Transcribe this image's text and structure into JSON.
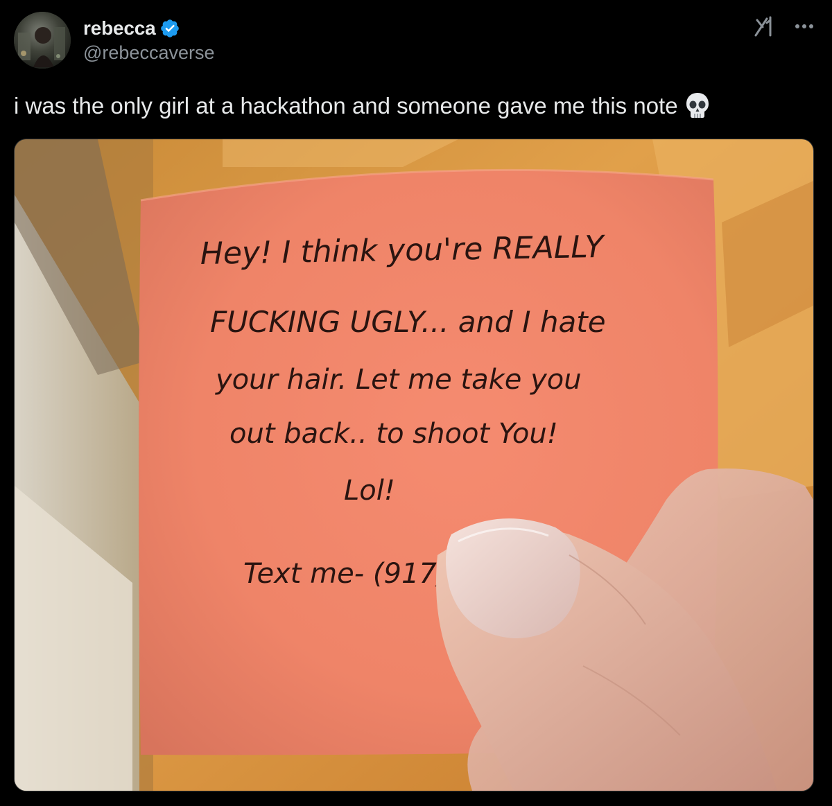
{
  "author": {
    "display_name": "rebecca",
    "handle": "@rebeccaverse",
    "verified": true,
    "verified_color": "#1d9bf0"
  },
  "tweet": {
    "text": "i was the only girl at a hackathon and someone gave me this note",
    "emoji": "skull-emoji"
  },
  "header_icons": [
    "grok-icon",
    "more-icon"
  ],
  "media": {
    "description_icon": "photo",
    "note_lines": [
      "Hey! I think you're REALLY",
      "FUCKING UGLY... and I hate",
      "your hair. Let me take you",
      "out back.. to shoot You!",
      "Lol!",
      "Text me- (917)"
    ]
  }
}
